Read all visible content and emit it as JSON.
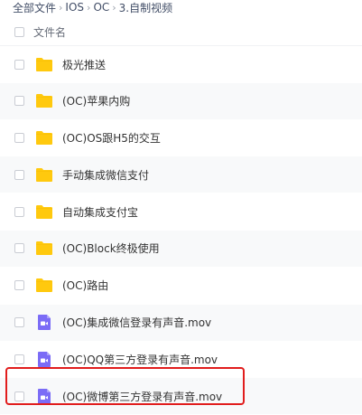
{
  "breadcrumb": {
    "items": [
      "全部文件",
      "IOS",
      "OC",
      "3.自制视频"
    ],
    "separator": "›"
  },
  "header": {
    "column_label": "文件名"
  },
  "files": [
    {
      "name": "极光推送",
      "type": "folder",
      "icon": "folder-icon"
    },
    {
      "name": "(OC)苹果内购",
      "type": "folder",
      "icon": "folder-icon"
    },
    {
      "name": "(OC)OS跟H5的交互",
      "type": "folder",
      "icon": "folder-icon"
    },
    {
      "name": "手动集成微信支付",
      "type": "folder",
      "icon": "folder-icon"
    },
    {
      "name": "自动集成支付宝",
      "type": "folder",
      "icon": "folder-icon"
    },
    {
      "name": "(OC)Block终极使用",
      "type": "folder",
      "icon": "folder-icon"
    },
    {
      "name": "(OC)路由",
      "type": "folder",
      "icon": "folder-icon"
    },
    {
      "name": "(OC)集成微信登录有声音.mov",
      "type": "video",
      "icon": "video-file-icon"
    },
    {
      "name": "(OC)QQ第三方登录有声音.mov",
      "type": "video",
      "icon": "video-file-icon"
    },
    {
      "name": "(OC)微博第三方登录有声音.mov",
      "type": "video",
      "icon": "video-file-icon",
      "highlighted": true
    }
  ],
  "colors": {
    "folder": "#ffc90e",
    "video": "#7b6cf6",
    "highlight": "#e11d1d",
    "row_alt": "#f8f9fa"
  }
}
